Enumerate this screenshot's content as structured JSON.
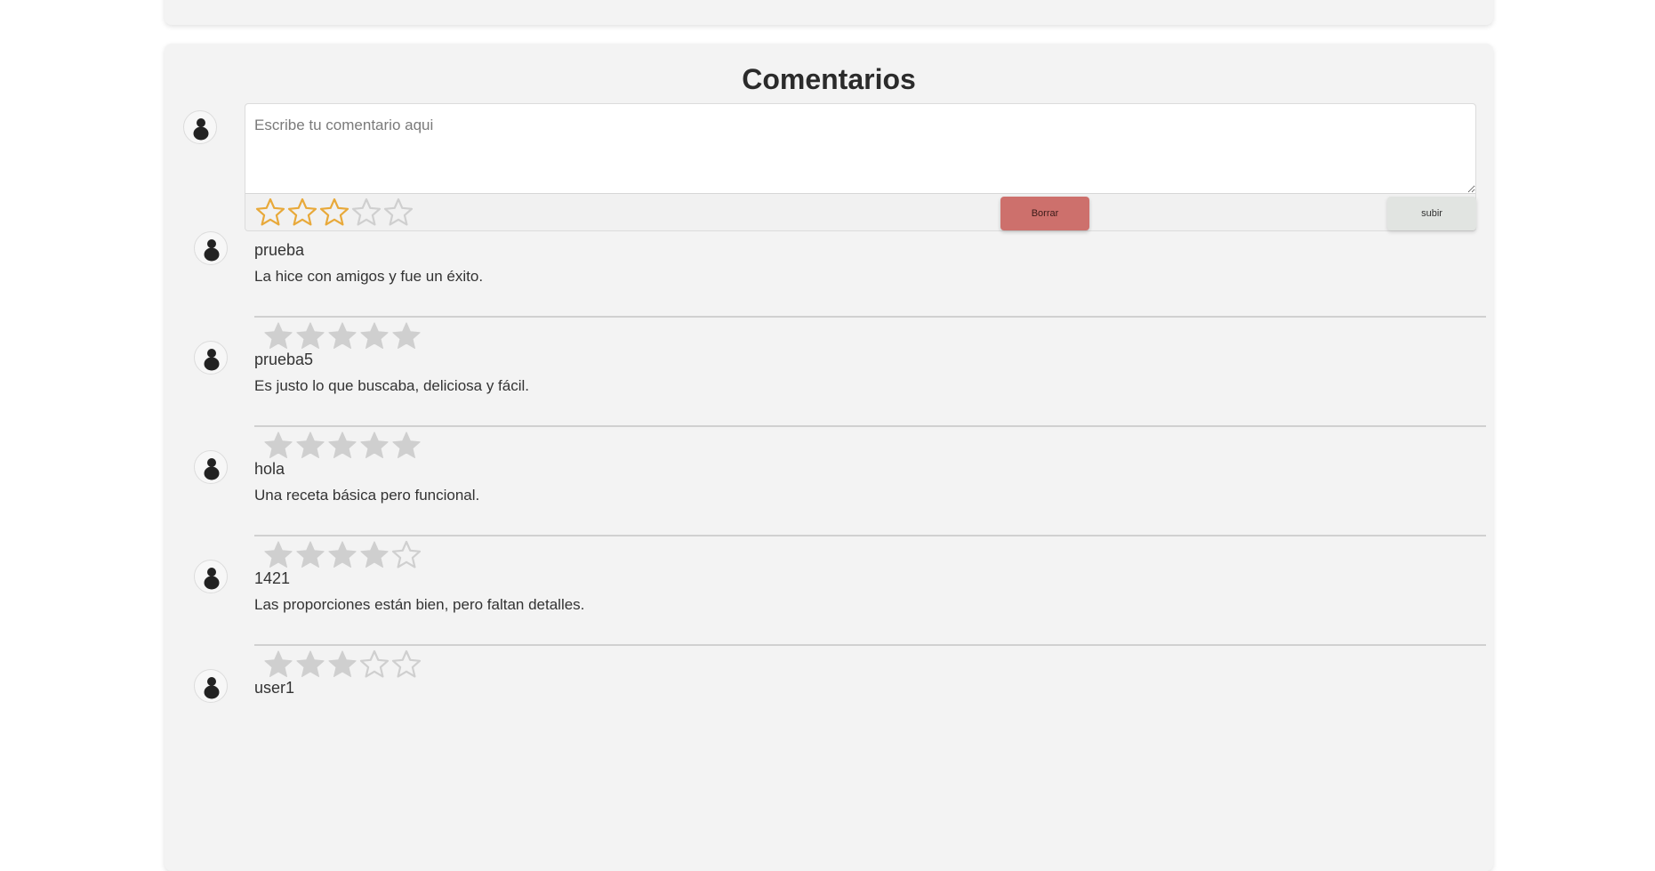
{
  "colors": {
    "card_bg": "#f3f3f3",
    "star_active_outline": "#e8a93a",
    "star_inactive": "#cfcfcf",
    "delete_button": "#cd706c",
    "submit_button": "#e1e4e1"
  },
  "comments_section": {
    "title": "Comentarios",
    "composer": {
      "placeholder": "Escribe tu comentario aqui",
      "value": "",
      "rating": 3,
      "rating_max": 5,
      "delete_label": "Borrar",
      "submit_label": "subir"
    },
    "comments": [
      {
        "user": "prueba",
        "text": "La hice con amigos y fue un éxito.",
        "rating": 5
      },
      {
        "user": "prueba5",
        "text": "Es justo lo que buscaba, deliciosa y fácil.",
        "rating": 5
      },
      {
        "user": "hola",
        "text": "Una receta básica pero funcional.",
        "rating": 4
      },
      {
        "user": "1421",
        "text": "Las proporciones están bien, pero faltan detalles.",
        "rating": 3
      },
      {
        "user": "user1",
        "text": "",
        "rating": 0
      }
    ]
  }
}
